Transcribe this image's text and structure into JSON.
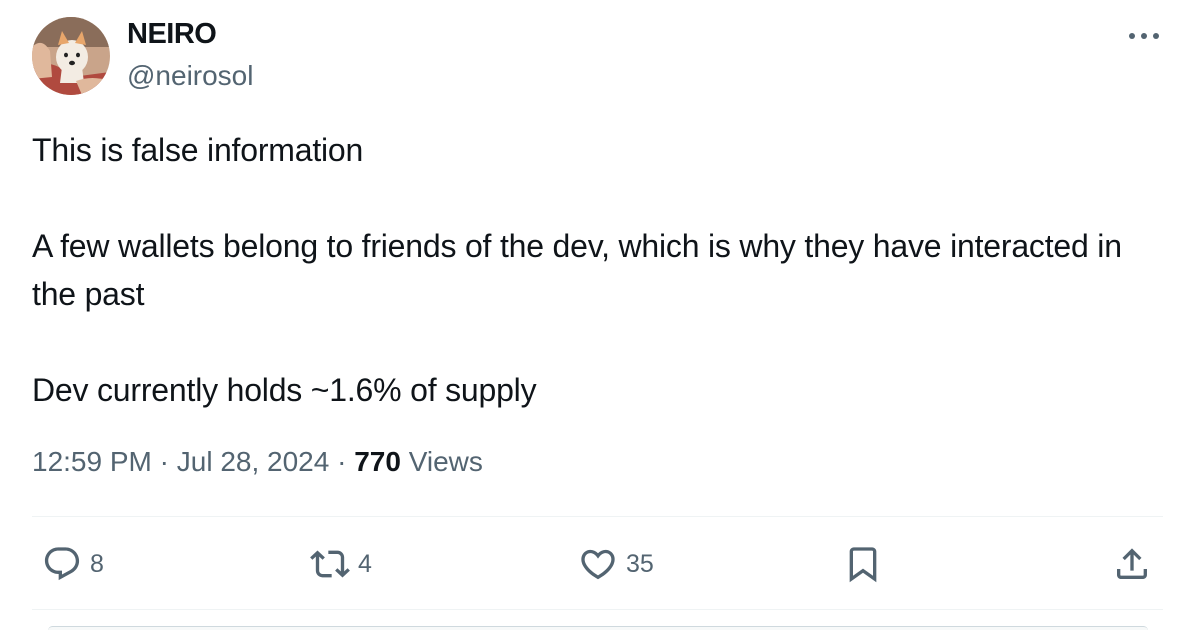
{
  "author": {
    "display_name": "NEIRO",
    "handle": "@neirosol"
  },
  "tweet": {
    "paragraphs": [
      "This is false information",
      "A few wallets belong to friends of the dev, which is why they have interacted in the past",
      "Dev currently holds ~1.6% of supply"
    ],
    "time": "12:59 PM",
    "separator": " · ",
    "date": "Jul 28, 2024",
    "views_count": "770",
    "views_label": "Views"
  },
  "actions": {
    "reply": {
      "icon": "reply-icon",
      "count": "8"
    },
    "retweet": {
      "icon": "retweet-icon",
      "count": "4"
    },
    "like": {
      "icon": "heart-icon",
      "count": "35"
    },
    "bookmark": {
      "icon": "bookmark-icon"
    },
    "share": {
      "icon": "share-icon"
    }
  },
  "colors": {
    "text_primary": "#0f1419",
    "text_secondary": "#536471",
    "divider": "#eff3f4"
  }
}
